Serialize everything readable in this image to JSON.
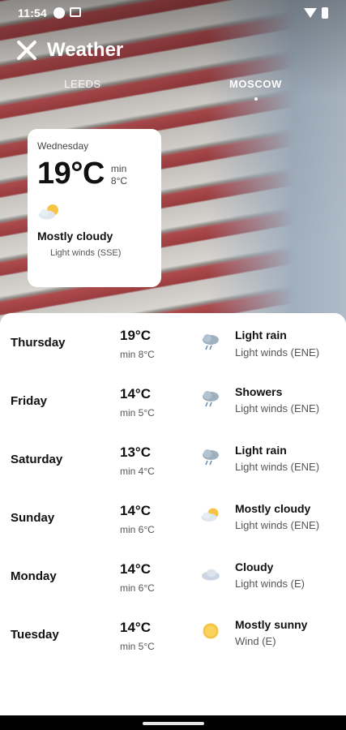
{
  "status_bar": {
    "time": "11:54"
  },
  "app_bar": {
    "title": "Weather"
  },
  "tabs": [
    {
      "label": "LEEDS",
      "active": false
    },
    {
      "label": "MOSCOW",
      "active": true
    }
  ],
  "current": {
    "day": "Wednesday",
    "temp": "19°C",
    "min_label": "min",
    "min_value": "8°C",
    "icon": "partly-cloudy-icon",
    "condition": "Mostly cloudy",
    "wind": "Light winds (SSE)"
  },
  "forecast": [
    {
      "day": "Thursday",
      "temp": "19°C",
      "min": "min 8°C",
      "icon": "rain-cloud-icon",
      "condition": "Light rain",
      "wind": "Light winds (ENE)"
    },
    {
      "day": "Friday",
      "temp": "14°C",
      "min": "min 5°C",
      "icon": "rain-cloud-icon",
      "condition": "Showers",
      "wind": "Light winds (ENE)"
    },
    {
      "day": "Saturday",
      "temp": "13°C",
      "min": "min 4°C",
      "icon": "rain-cloud-icon",
      "condition": "Light rain",
      "wind": "Light winds (ENE)"
    },
    {
      "day": "Sunday",
      "temp": "14°C",
      "min": "min 6°C",
      "icon": "partly-cloudy-icon",
      "condition": "Mostly cloudy",
      "wind": "Light winds (ENE)"
    },
    {
      "day": "Monday",
      "temp": "14°C",
      "min": "min 6°C",
      "icon": "cloud-icon",
      "condition": "Cloudy",
      "wind": "Light winds (E)"
    },
    {
      "day": "Tuesday",
      "temp": "14°C",
      "min": "min 5°C",
      "icon": "sun-icon",
      "condition": "Mostly sunny",
      "wind": "Wind (E)"
    }
  ]
}
